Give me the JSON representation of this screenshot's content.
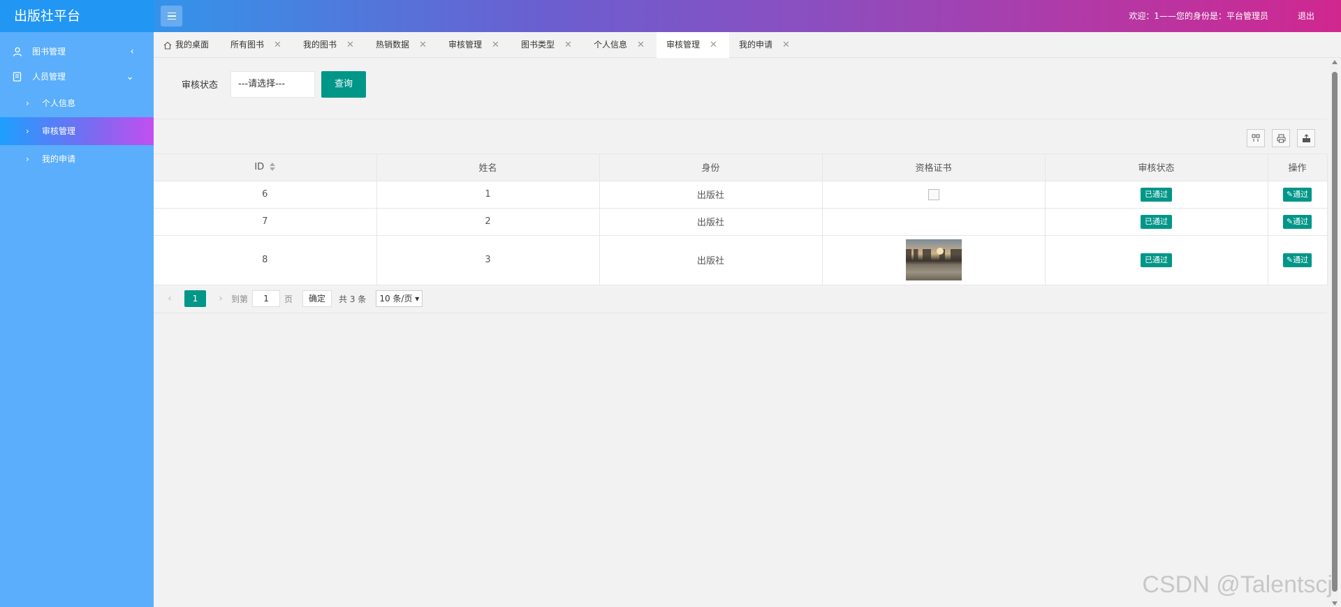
{
  "header": {
    "brand": "出版社平台",
    "welcome": "欢迎：1——您的身份是：平台管理员",
    "logout": "退出"
  },
  "sidebar": {
    "groups": [
      {
        "label": "图书管理",
        "chevron": "‹"
      },
      {
        "label": "人员管理",
        "chevron": "⌄"
      }
    ],
    "subitems": [
      {
        "label": "个人信息"
      },
      {
        "label": "审核管理"
      },
      {
        "label": "我的申请"
      }
    ]
  },
  "tabs": [
    {
      "label": "我的桌面"
    },
    {
      "label": "所有图书",
      "close": "✕"
    },
    {
      "label": "我的图书",
      "close": "✕"
    },
    {
      "label": "热销数据",
      "close": "✕"
    },
    {
      "label": "审核管理",
      "close": "✕"
    },
    {
      "label": "图书类型",
      "close": "✕"
    },
    {
      "label": "个人信息",
      "close": "✕"
    },
    {
      "label": "审核管理",
      "close": "✕"
    },
    {
      "label": "我的申请",
      "close": "✕"
    }
  ],
  "search": {
    "label": "审核状态",
    "select_value": "---请选择---",
    "query_button": "查询"
  },
  "table": {
    "columns": [
      "ID",
      "姓名",
      "身份",
      "资格证书",
      "审核状态",
      "操作"
    ],
    "rows": [
      {
        "id": "6",
        "name": "1",
        "role": "出版社",
        "cert": "broken-image",
        "status": "已通过",
        "action": "✎通过"
      },
      {
        "id": "7",
        "name": "2",
        "role": "出版社",
        "cert": "none",
        "status": "已通过",
        "action": "✎通过"
      },
      {
        "id": "8",
        "name": "3",
        "role": "出版社",
        "cert": "photo",
        "status": "已通过",
        "action": "✎通过"
      }
    ]
  },
  "pager": {
    "prev": "‹",
    "current": "1",
    "next": "›",
    "goto_label": "到第",
    "goto_value": "1",
    "page_unit": "页",
    "confirm": "确定",
    "total": "共 3 条",
    "page_size": "10 条/页"
  },
  "watermark": "CSDN @Talentscj",
  "colors": {
    "accent": "#009688",
    "sidebar": "#5aaefb",
    "brand_bg": "#2196f3"
  }
}
